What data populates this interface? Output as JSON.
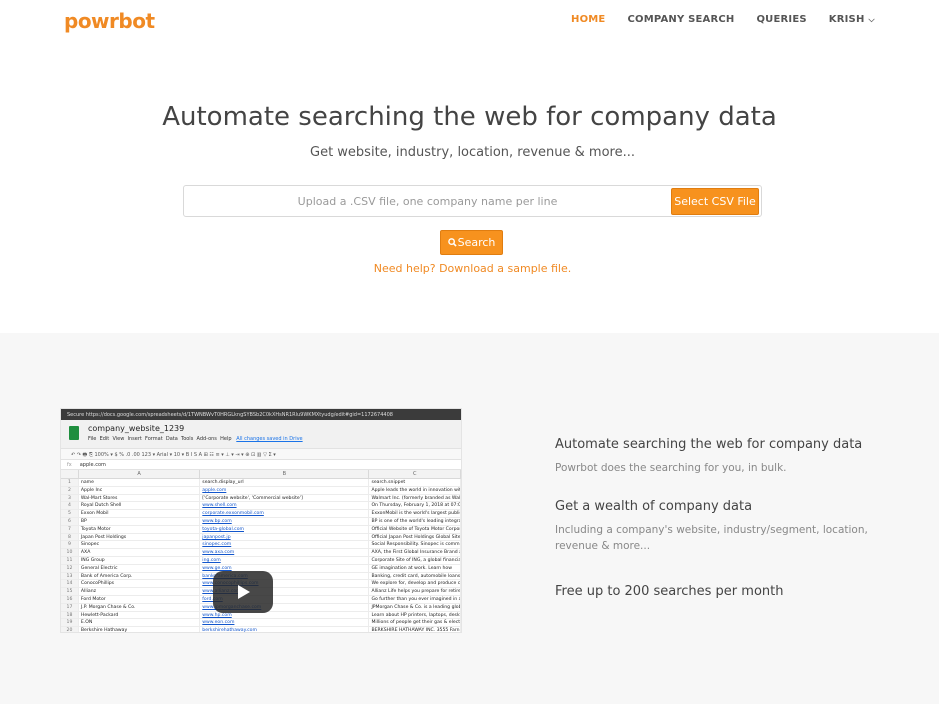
{
  "brand": {
    "logo": "powrbot",
    "accent": "#f7921e"
  },
  "nav": {
    "items": [
      {
        "label": "HOME",
        "active": true
      },
      {
        "label": "COMPANY SEARCH",
        "active": false
      },
      {
        "label": "QUERIES",
        "active": false
      },
      {
        "label": "KRISH",
        "active": false,
        "dropdown": true
      }
    ]
  },
  "hero": {
    "title": "Automate searching the web for company data",
    "subtitle": "Get website, industry, location, revenue & more...",
    "upload_placeholder": "Upload a .CSV file, one company name per line",
    "select_label": "Select CSV File",
    "search_label": "Search",
    "help_link": "Need help? Download a sample file."
  },
  "video": {
    "browser_url": "Secure  https://docs.google.com/spreadsheets/d/1TWNBWvT0HRGLkngSYBSb2C0kXHsNR1Rlu9WKMXtyudg/edit#gid=1172674408",
    "doc_title": "company_website_1239",
    "menu": [
      "File",
      "Edit",
      "View",
      "Insert",
      "Format",
      "Data",
      "Tools",
      "Add-ons",
      "Help"
    ],
    "saved_text": "All changes saved in Drive",
    "toolbar": "↶  ↷  🖶  ⎘   100% ▾   $  %  .0  .00  123 ▾   Arial ▾   10 ▾   B  I  S  A   ⊞  ☷   ≡ ▾  ⊥ ▾  ⇥ ▾   ⊕  ⊡  ▥  ▽  Σ ▾",
    "formula_label": "fx",
    "formula_value": "apple.com",
    "columns": [
      "A",
      "B",
      "C"
    ],
    "rows": [
      [
        "1",
        "name",
        "search.display_url",
        "search.snippet"
      ],
      [
        "2",
        "Apple Inc",
        "apple.com",
        "Apple leads the world in innovation with iP"
      ],
      [
        "3",
        "Wal-Mart Stores",
        "['Corporate website', 'Commercial website']",
        "Walmart Inc. (formerly branded as Wal-Ma"
      ],
      [
        "4",
        "Royal Dutch Shell",
        "www.shell.com",
        "On Thursday, February 1, 2018 at 07:00 G"
      ],
      [
        "5",
        "Exxon Mobil",
        "corporate.exxonmobil.com",
        "ExxonMobil is the world's largest publicly t"
      ],
      [
        "6",
        "BP",
        "www.bp.com",
        "BP is one of the world's leading integrated"
      ],
      [
        "7",
        "Toyota Motor",
        "toyota-global.com",
        "Official Website of Toyota Motor Corporatio"
      ],
      [
        "8",
        "Japan Post Holdings",
        "japanpost.jp",
        "Official Japan Post Holdings Global Site. T"
      ],
      [
        "9",
        "Sinopec",
        "sinopec.com",
        "Social Responsibility. Sinopec is committe"
      ],
      [
        "10",
        "AXA",
        "www.axa.com",
        "AXA, the First Global Insurance Brand as f"
      ],
      [
        "11",
        "ING Group",
        "ing.com",
        "Corporate Site of ING, a global financial in"
      ],
      [
        "12",
        "General Electric",
        "www.ge.com",
        "GE imagination at work. Learn how"
      ],
      [
        "13",
        "Bank of America Corp.",
        "bankofamerica.com",
        "Banking, credit card, automobile loans, mo"
      ],
      [
        "14",
        "ConocoPhillips",
        "www.conocophillips.com",
        "We explore for, develop and produce crude"
      ],
      [
        "15",
        "Allianz",
        "www.allianz.com",
        "Allianz Life helps you prepare for retiremen"
      ],
      [
        "16",
        "Ford Motor",
        "ford.com",
        "Go further than you ever imagined in a new"
      ],
      [
        "17",
        "J.P. Morgan Chase & Co.",
        "www.jpmorganchase.com",
        "JPMorgan Chase & Co. is a leading global"
      ],
      [
        "18",
        "Hewlett-Packard",
        "www.hp.com",
        "Learn about HP printers, laptops, desktop"
      ],
      [
        "19",
        "E.ON",
        "www.eon.com",
        "Millions of people get their gas & electricity"
      ],
      [
        "20",
        "Berkshire Hathaway",
        "berkshirehathaway.com",
        "BERKSHIRE HATHAWAY INC. 3555 Farn"
      ]
    ]
  },
  "features": [
    {
      "title": "Automate searching the web for company data",
      "desc": "Powrbot does the searching for you, in bulk."
    },
    {
      "title": "Get a wealth of company data",
      "desc": "Including a company's website, industry/segment, location, revenue & more..."
    },
    {
      "title": "Free up to 200 searches per month",
      "desc": ""
    }
  ]
}
